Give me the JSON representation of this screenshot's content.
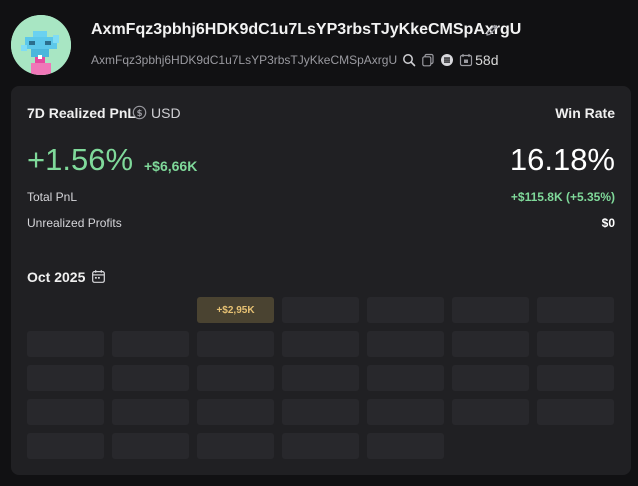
{
  "header": {
    "wallet_name": "AxmFqz3pbhj6HDK9dC1u7LsYP3rbsTJyKkeCMSpAxrgU",
    "address": "AxmFqz3pbhj6HDK9dC1u7LsYP3rbsTJyKkeCMSpAxrgU",
    "age": "58d",
    "icons": [
      "avatar-image",
      "edit-icon",
      "search-icon",
      "copy-icon",
      "wallet-type-icon",
      "age-icon"
    ]
  },
  "pnl": {
    "title": "7D Realized PnL",
    "currency": "USD",
    "currency_icon": "dollar-circle-icon",
    "percent": "+1.56%",
    "amount": "+$6,66K",
    "win_rate_label": "Win Rate",
    "win_rate_value": "16.18%",
    "rows": [
      {
        "label": "Total PnL",
        "value": "+$115.8K (+5.35%)",
        "color": "#7fd99a"
      },
      {
        "label": "Unrealized Profits",
        "value": "$0",
        "color": "#ffffff"
      }
    ]
  },
  "calendar": {
    "month": "Oct 2025",
    "icon": "calendar-icon",
    "leading_blanks": 2,
    "days": [
      {
        "pnl": "+$2,95K",
        "type": "profit"
      },
      {
        "pnl": "",
        "type": "none"
      },
      {
        "pnl": "",
        "type": "none"
      },
      {
        "pnl": "",
        "type": "none"
      },
      {
        "pnl": "",
        "type": "none"
      },
      {
        "pnl": "",
        "type": "none"
      },
      {
        "pnl": "",
        "type": "none"
      },
      {
        "pnl": "",
        "type": "none"
      },
      {
        "pnl": "",
        "type": "none"
      },
      {
        "pnl": "",
        "type": "none"
      },
      {
        "pnl": "",
        "type": "none"
      },
      {
        "pnl": "",
        "type": "none"
      },
      {
        "pnl": "",
        "type": "none"
      },
      {
        "pnl": "",
        "type": "none"
      },
      {
        "pnl": "",
        "type": "none"
      },
      {
        "pnl": "",
        "type": "none"
      },
      {
        "pnl": "",
        "type": "none"
      },
      {
        "pnl": "",
        "type": "none"
      },
      {
        "pnl": "",
        "type": "none"
      },
      {
        "pnl": "",
        "type": "none"
      },
      {
        "pnl": "",
        "type": "none"
      },
      {
        "pnl": "",
        "type": "none"
      },
      {
        "pnl": "",
        "type": "none"
      },
      {
        "pnl": "",
        "type": "none"
      },
      {
        "pnl": "",
        "type": "none"
      },
      {
        "pnl": "",
        "type": "none"
      },
      {
        "pnl": "",
        "type": "none"
      },
      {
        "pnl": "",
        "type": "none"
      },
      {
        "pnl": "",
        "type": "none"
      },
      {
        "pnl": "",
        "type": "none"
      },
      {
        "pnl": "",
        "type": "none"
      }
    ]
  },
  "colors": {
    "background": "#111113",
    "card": "#202023",
    "positive": "#7fd99a",
    "profit_cell": "#4a4331",
    "profit_text": "#e6c173"
  }
}
